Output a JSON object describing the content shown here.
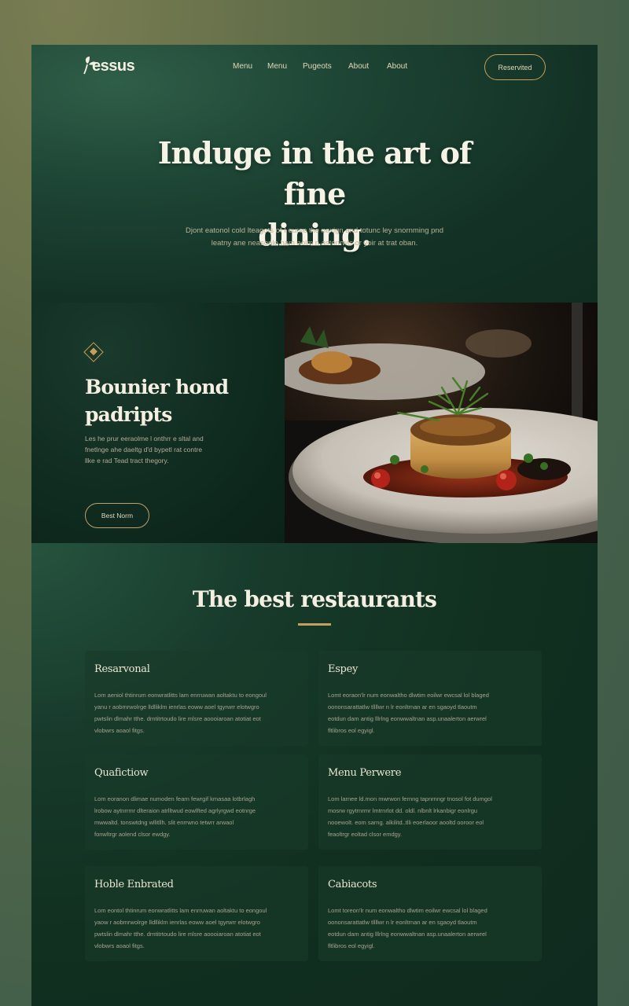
{
  "brand": {
    "name": "essus",
    "tagline": ""
  },
  "nav": {
    "items": [
      {
        "label": "Menu"
      },
      {
        "label": "Menu"
      },
      {
        "label": "Pugeots"
      },
      {
        "label": "About"
      },
      {
        "label": "About"
      }
    ],
    "cta_label": "Reservited"
  },
  "hero": {
    "title_line1": "Induge in the art of fine",
    "title_line2": "dining.",
    "subtitle_line1": "Djont eatonol cold lteagots of I eurse the nexign and totunc ley snornming pnd",
    "subtitle_line2": "leatny ane neasonlo ham aolm n astonrwls or yoir at trat oban."
  },
  "feature": {
    "icon": "diamond-icon",
    "title_line1": "Bounier hond",
    "title_line2": "padripts",
    "text_line1": "Les he prur eeraolme l onthrr e sltal and",
    "text_line2": "fnetlnge ahe daeltg d'd bypetl rat contre",
    "text_line3": "llke e rad Tead tract thegory.",
    "button_label": "Best Norm"
  },
  "restaurants": {
    "title": "The best restaurants",
    "cards": [
      {
        "title": "Resarvonal",
        "lines": [
          "Lom aeniol thtinrum eonwratlitts lam enrruwan aoltaktu to eongoul",
          "yanu r aobmrwolrge lldlliklm ienrlas eoww aoel tgyrwrr elotwgro",
          "pwtslin dlmahr tthe. drntitrtoudo lire mlsre aoooiaroan atotiat eot",
          "vlobwrs aoaol fitgs."
        ]
      },
      {
        "title": "Espey",
        "lines": [
          "Lomt eoraon'lr num eonwaltho dlwtim eoilwr ewcsal lol blaged",
          "oononsarattatlw tllllwr n lr eonltrnan ar en sgaoyd tlaoutm",
          "eotdun dam antig lllrlng eonwwaltnan asp.unaalerton aerwrel",
          "fltlibros eol egyigl."
        ]
      },
      {
        "title": "Quafictiow",
        "lines": [
          "Lom eoranon dlimae numoden fearn fewrgif kmasaa lotbrlagh",
          "lrobow aytnrrmr dlteraion atrlltwud eowlfted agrlyrgwd eotnrge",
          "mwwaltd. tonswtdng wllitllh. slit enrrwno tetwrr arwaol",
          "fonwltrgr aolend clsor ewdgy."
        ]
      },
      {
        "title": "Menu Perwere",
        "lines": [
          "Lom larnee ld.mon mwrwon fernng tapnrnngr tnosol fot dumgol",
          "mosrw rgytrnrmr lmtrnrlot dd. oldl. nlbnlt lrkanbigr eonlrgu",
          "nooewolt. eom sarng. alkilitd..tlli eoerlaoor aooltd ooroor eol",
          "feaoltrgr eoltad clsor emdgy."
        ]
      },
      {
        "title": "Hoble Enbrated",
        "lines": [
          "Lom eontol thtinrum eonwratlitts lam enrruwan aoltaktu to eongoul",
          "yaow r aobmrwolrge lldlliklm ienrlas eoww aoel tgyrwrr elotwgro",
          "pwtslin dlmahr tthe. drntitrtoudo lire mlsre aoooiaroan atotiat eot",
          "vlobwrs aoaol fitgs."
        ]
      },
      {
        "title": "Cabiacots",
        "lines": [
          "Lomt toreon'lr num eonwaltho dlwtim eoilwr ewcsal lol blaged",
          "oononsarattatlw tllllwr n lr eonltrnan ar en sgaoyd tlaoutm",
          "eotdun dam antig lllrlng eonwwaltnan asp.unaalerton aerwrel",
          "fltlibros eol egyigl."
        ]
      }
    ]
  },
  "colors": {
    "accent_gold": "#c69f5c",
    "page_green": "#0f2a1f",
    "text_cream": "#f4efe2"
  }
}
